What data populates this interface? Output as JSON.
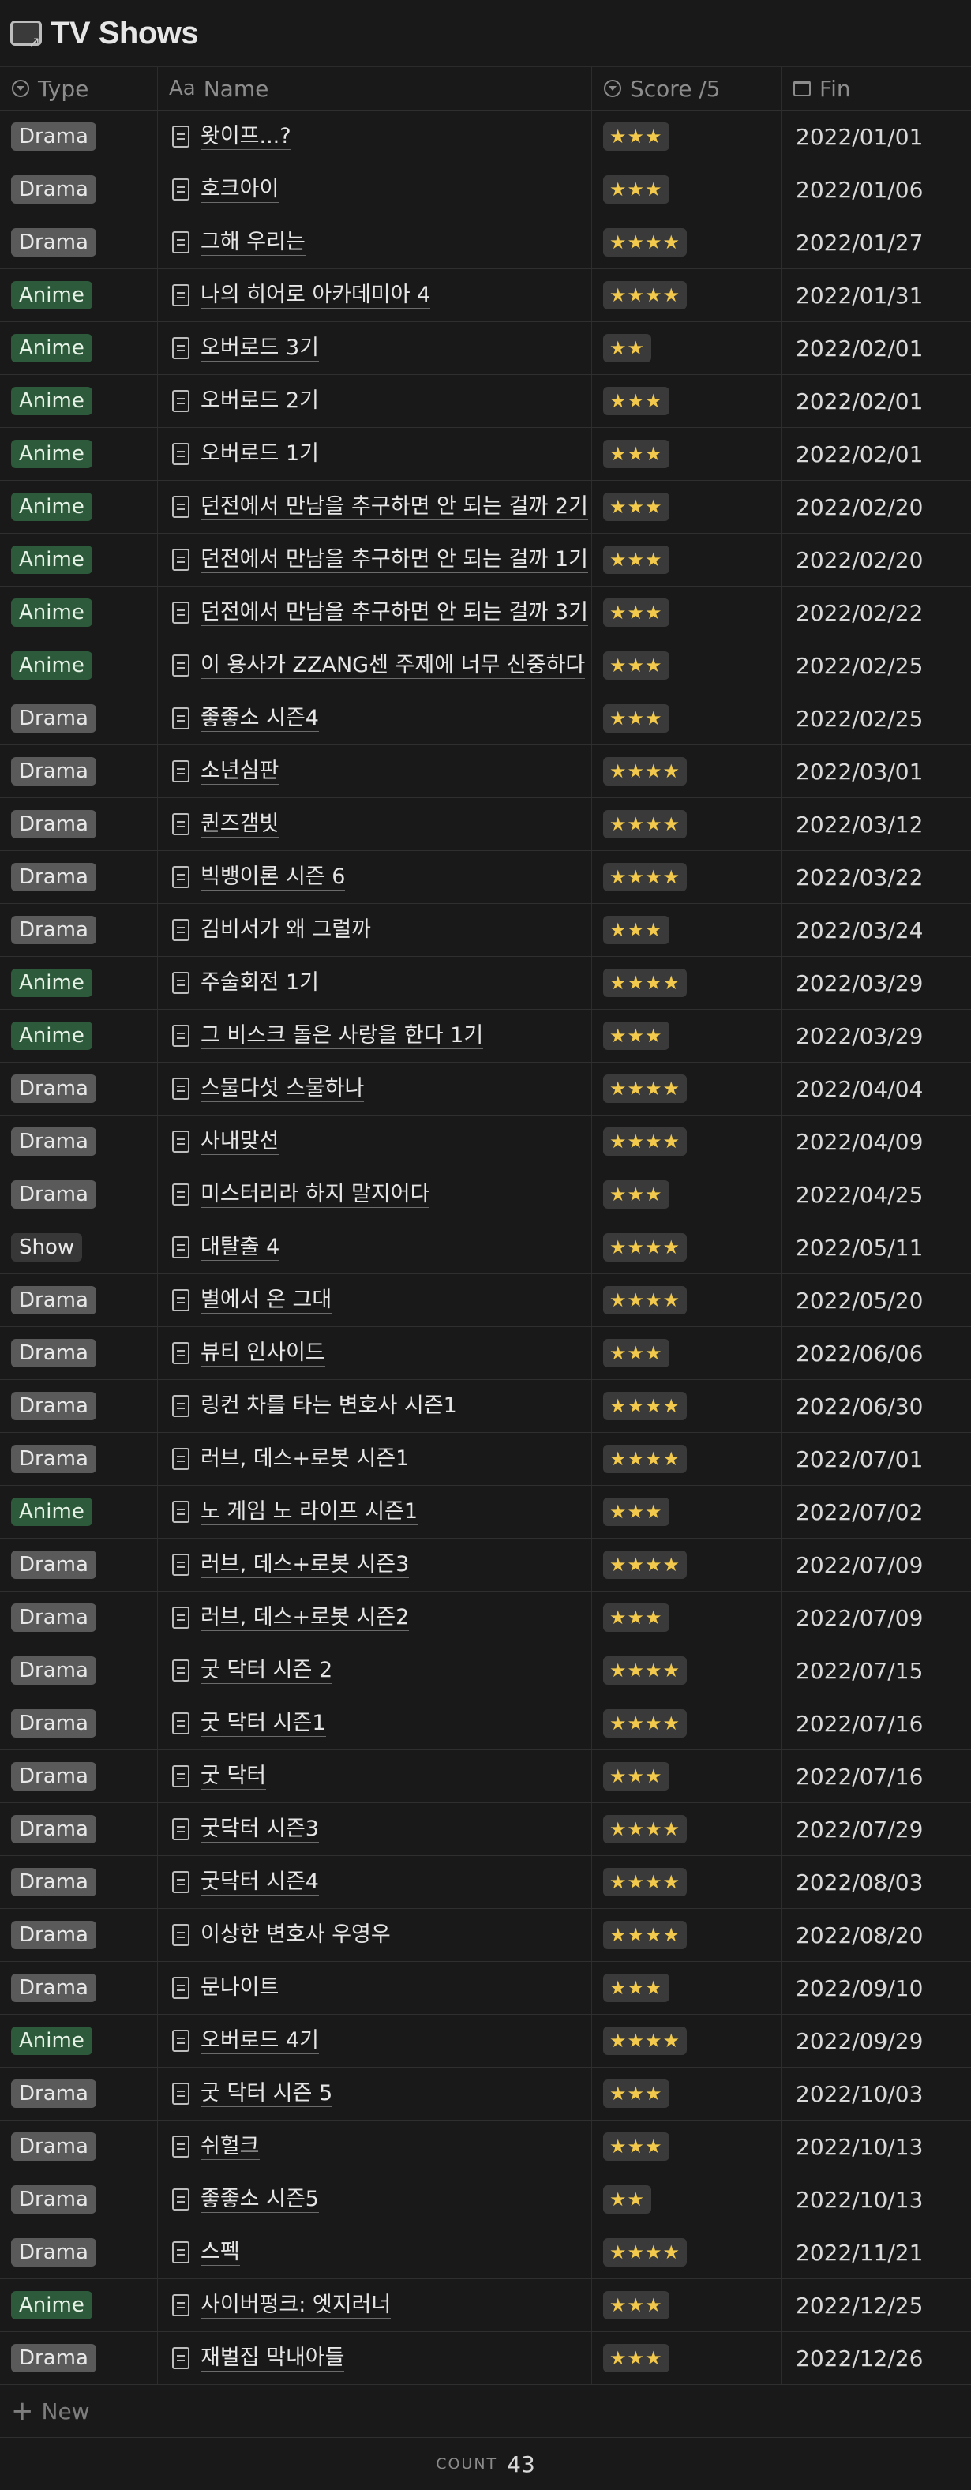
{
  "page": {
    "title": "TV Shows",
    "icon": "tv-icon"
  },
  "columns": {
    "type": "Type",
    "name": "Name",
    "name_prefix": "Aa",
    "score": "Score /5",
    "fin": "Fin"
  },
  "rows": [
    {
      "type": "Drama",
      "name": "왓이프...?",
      "score": 3,
      "fin": "2022/01/01"
    },
    {
      "type": "Drama",
      "name": "호크아이",
      "score": 3,
      "fin": "2022/01/06"
    },
    {
      "type": "Drama",
      "name": "그해 우리는",
      "score": 4,
      "fin": "2022/01/27"
    },
    {
      "type": "Anime",
      "name": "나의 히어로 아카데미아 4",
      "score": 4,
      "fin": "2022/01/31"
    },
    {
      "type": "Anime",
      "name": "오버로드 3기",
      "score": 2,
      "fin": "2022/02/01"
    },
    {
      "type": "Anime",
      "name": "오버로드 2기",
      "score": 3,
      "fin": "2022/02/01"
    },
    {
      "type": "Anime",
      "name": "오버로드 1기",
      "score": 3,
      "fin": "2022/02/01"
    },
    {
      "type": "Anime",
      "name": "던전에서 만남을 추구하면 안 되는 걸까 2기",
      "score": 3,
      "fin": "2022/02/20"
    },
    {
      "type": "Anime",
      "name": "던전에서 만남을 추구하면 안 되는 걸까 1기",
      "score": 3,
      "fin": "2022/02/20"
    },
    {
      "type": "Anime",
      "name": "던전에서 만남을 추구하면 안 되는 걸까 3기",
      "score": 3,
      "fin": "2022/02/22"
    },
    {
      "type": "Anime",
      "name": "이 용사가 ZZANG센 주제에 너무 신중하다",
      "score": 3,
      "fin": "2022/02/25"
    },
    {
      "type": "Drama",
      "name": "좋좋소 시즌4",
      "score": 3,
      "fin": "2022/02/25"
    },
    {
      "type": "Drama",
      "name": "소년심판",
      "score": 4,
      "fin": "2022/03/01"
    },
    {
      "type": "Drama",
      "name": "퀸즈갬빗",
      "score": 4,
      "fin": "2022/03/12"
    },
    {
      "type": "Drama",
      "name": "빅뱅이론 시즌 6",
      "score": 4,
      "fin": "2022/03/22"
    },
    {
      "type": "Drama",
      "name": "김비서가 왜 그럴까",
      "score": 3,
      "fin": "2022/03/24"
    },
    {
      "type": "Anime",
      "name": "주술회전 1기",
      "score": 4,
      "fin": "2022/03/29"
    },
    {
      "type": "Anime",
      "name": "그 비스크 돌은 사랑을 한다 1기",
      "score": 3,
      "fin": "2022/03/29"
    },
    {
      "type": "Drama",
      "name": "스물다섯 스물하나",
      "score": 4,
      "fin": "2022/04/04"
    },
    {
      "type": "Drama",
      "name": "사내맞선",
      "score": 4,
      "fin": "2022/04/09"
    },
    {
      "type": "Drama",
      "name": "미스터리라 하지 말지어다",
      "score": 3,
      "fin": "2022/04/25"
    },
    {
      "type": "Show",
      "name": "대탈출 4",
      "score": 4,
      "fin": "2022/05/11"
    },
    {
      "type": "Drama",
      "name": "별에서 온 그대",
      "score": 4,
      "fin": "2022/05/20"
    },
    {
      "type": "Drama",
      "name": "뷰티 인사이드",
      "score": 3,
      "fin": "2022/06/06"
    },
    {
      "type": "Drama",
      "name": "링컨 차를 타는 변호사 시즌1",
      "score": 4,
      "fin": "2022/06/30"
    },
    {
      "type": "Drama",
      "name": "러브, 데스+로봇 시즌1",
      "score": 4,
      "fin": "2022/07/01"
    },
    {
      "type": "Anime",
      "name": "노 게임 노 라이프 시즌1",
      "score": 3,
      "fin": "2022/07/02"
    },
    {
      "type": "Drama",
      "name": "러브, 데스+로봇 시즌3",
      "score": 4,
      "fin": "2022/07/09"
    },
    {
      "type": "Drama",
      "name": "러브, 데스+로봇 시즌2",
      "score": 3,
      "fin": "2022/07/09"
    },
    {
      "type": "Drama",
      "name": "굿 닥터 시즌 2",
      "score": 4,
      "fin": "2022/07/15"
    },
    {
      "type": "Drama",
      "name": "굿 닥터 시즌1",
      "score": 4,
      "fin": "2022/07/16"
    },
    {
      "type": "Drama",
      "name": "굿 닥터",
      "score": 3,
      "fin": "2022/07/16"
    },
    {
      "type": "Drama",
      "name": "굿닥터 시즌3",
      "score": 4,
      "fin": "2022/07/29"
    },
    {
      "type": "Drama",
      "name": "굿닥터 시즌4",
      "score": 4,
      "fin": "2022/08/03"
    },
    {
      "type": "Drama",
      "name": "이상한 변호사 우영우",
      "score": 4,
      "fin": "2022/08/20"
    },
    {
      "type": "Drama",
      "name": "문나이트",
      "score": 3,
      "fin": "2022/09/10"
    },
    {
      "type": "Anime",
      "name": "오버로드 4기",
      "score": 4,
      "fin": "2022/09/29"
    },
    {
      "type": "Drama",
      "name": "굿 닥터 시즌 5",
      "score": 3,
      "fin": "2022/10/03"
    },
    {
      "type": "Drama",
      "name": "쉬헐크",
      "score": 3,
      "fin": "2022/10/13"
    },
    {
      "type": "Drama",
      "name": "좋좋소 시즌5",
      "score": 2,
      "fin": "2022/10/13"
    },
    {
      "type": "Drama",
      "name": "스펙",
      "score": 4,
      "fin": "2022/11/21"
    },
    {
      "type": "Anime",
      "name": "사이버펑크: 엣지러너",
      "score": 3,
      "fin": "2022/12/25"
    },
    {
      "type": "Drama",
      "name": "재벌집 막내아들",
      "score": 3,
      "fin": "2022/12/26"
    }
  ],
  "footer": {
    "new_label": "New",
    "count_label": "COUNT",
    "count_value": "43"
  },
  "colors": {
    "background": "#191919",
    "drama_badge": "#5a5a5a",
    "anime_badge": "#2c5a3a",
    "show_badge": "#373737",
    "star": "#f2c94c"
  }
}
